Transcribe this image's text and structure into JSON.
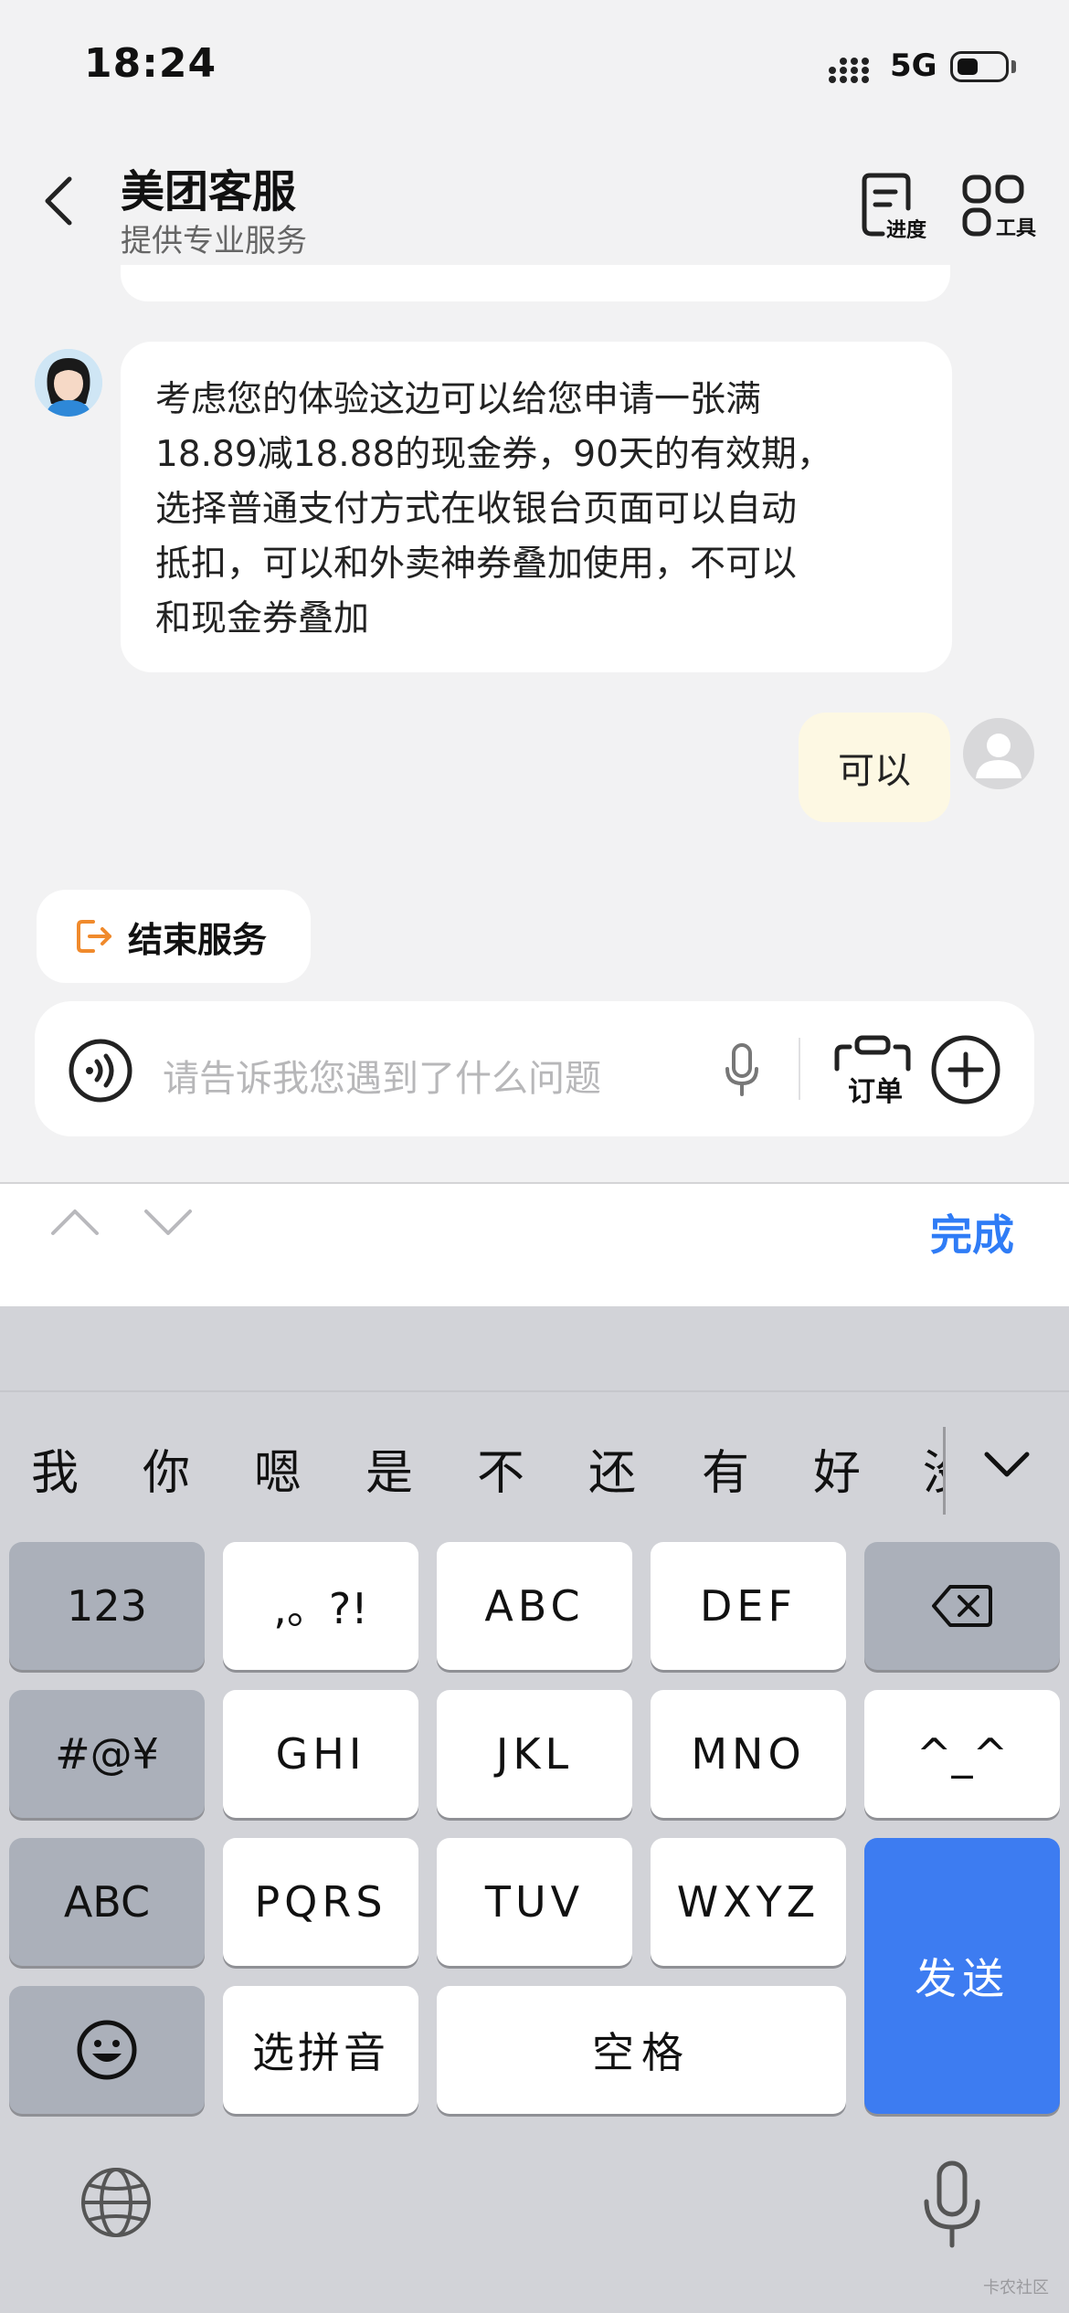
{
  "status_bar": {
    "time": "18:24",
    "network": "5G"
  },
  "header": {
    "title": "美团客服",
    "subtitle": "提供专业服务",
    "progress_label": "进度",
    "tools_label": "工具"
  },
  "chat": {
    "agent_message_lines": [
      "考虑您的体验这边可以给您申请一张满",
      "18.89减18.88的现金券，90天的有效期，",
      "选择普通支付方式在收银台页面可以自动",
      "抵扣，可以和外卖神券叠加使用，不可以",
      "和现金券叠加"
    ],
    "user_message": "可以"
  },
  "end_service_label": "结束服务",
  "input": {
    "placeholder": "请告诉我您遇到了什么问题",
    "order_label": "订单"
  },
  "accessory": {
    "done_label": "完成"
  },
  "keyboard": {
    "candidates": [
      "我",
      "你",
      "嗯",
      "是",
      "不",
      "还",
      "有",
      "好",
      "没"
    ],
    "keys": {
      "k123": "123",
      "punct": ",。?!",
      "abc": "ABC",
      "def": "DEF",
      "symbols": "#@¥",
      "ghi": "GHI",
      "jkl": "JKL",
      "mno": "MNO",
      "kaomoji": "^_^",
      "abc_mode": "ABC",
      "pqrs": "PQRS",
      "tuv": "TUV",
      "wxyz": "WXYZ",
      "send": "发送",
      "pinyin": "选拼音",
      "space": "空格"
    }
  },
  "watermark": "卡农社区",
  "colors": {
    "accent_blue": "#3d7cf1",
    "end_service_orange": "#f08a2c",
    "user_bubble": "#fdf8e3"
  }
}
